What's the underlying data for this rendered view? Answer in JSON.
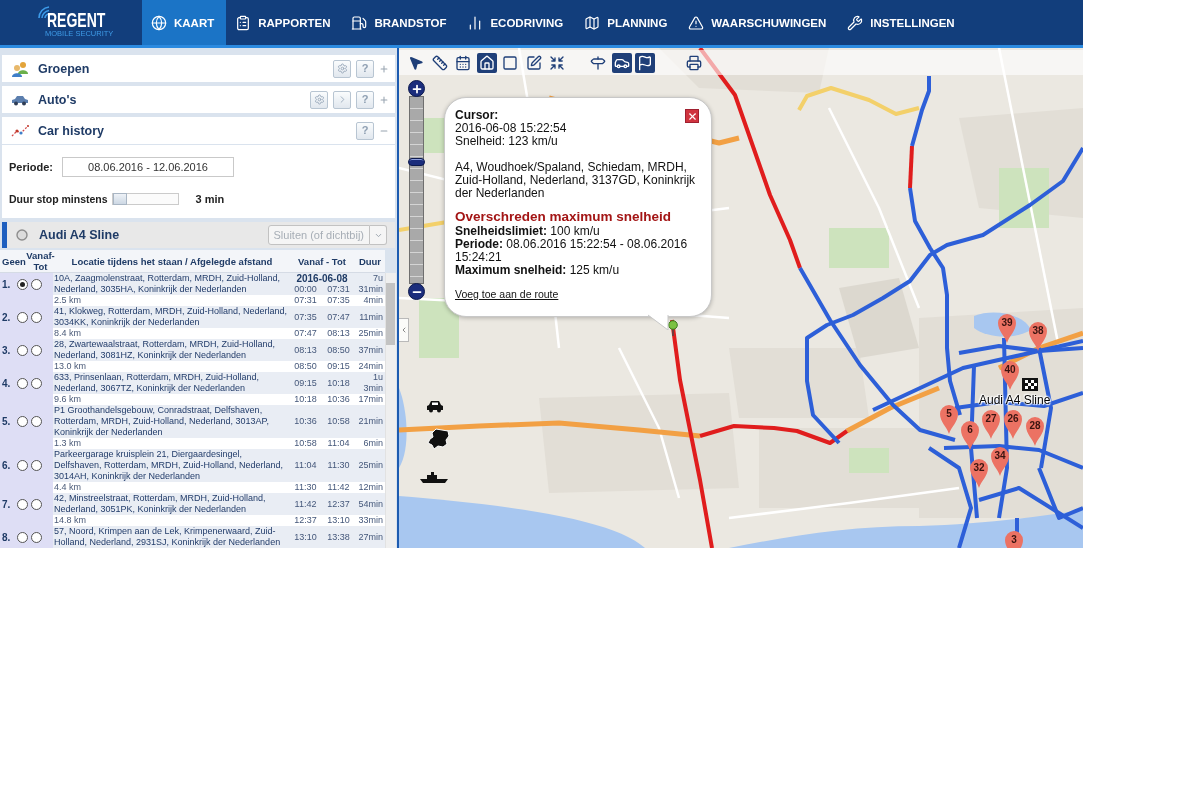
{
  "nav": {
    "logo": {
      "name": "REGENT",
      "tagline": "MOBILE SECURITY"
    },
    "tabs": [
      {
        "label": "KAART",
        "selected": true
      },
      {
        "label": "RAPPORTEN",
        "selected": false
      },
      {
        "label": "BRANDSTOF",
        "selected": false
      },
      {
        "label": "ECODRIVING",
        "selected": false
      },
      {
        "label": "PLANNING",
        "selected": false
      },
      {
        "label": "WAARSCHUWINGEN",
        "selected": false
      },
      {
        "label": "INSTELLINGEN",
        "selected": false
      }
    ]
  },
  "panels": [
    {
      "title": "Groepen",
      "expanded": false,
      "buttons": [
        {
          "kind": "settings"
        },
        {
          "kind": "help",
          "label": "?"
        }
      ]
    },
    {
      "title": "Auto's",
      "expanded": false,
      "buttons": [
        {
          "kind": "settings"
        },
        {
          "kind": "next"
        },
        {
          "kind": "help",
          "label": "?"
        }
      ]
    },
    {
      "title": "Car history",
      "expanded": true,
      "buttons": [
        {
          "kind": "help",
          "label": "?"
        }
      ]
    }
  ],
  "car_history": {
    "period": {
      "label": "Periode:",
      "value": "08.06.2016 - 12.06.2016"
    },
    "min_stop": {
      "label": "Duur stop minstens",
      "level": 0,
      "reading": "3 min"
    }
  },
  "vehicle": {
    "name": "Audi A4 Sline",
    "close_button": {
      "label": "Sluiten (of dichtbij)",
      "disabled": true
    }
  },
  "table": {
    "columns": [
      "Geen",
      "Vanaf-Tot",
      "Locatie tijdens het staan / Afgelegde afstand",
      "Vanaf - Tot",
      "Duur"
    ],
    "rows": [
      {
        "kind": "stop",
        "number": "1.",
        "options": [
          {
            "selected": true
          },
          {
            "selected": false
          }
        ],
        "location": "10A, Zaagmolenstraat, Rotterdam, MRDH, Zuid-Holland, Nederland, 3035HA, Koninkrijk der Nederlanden",
        "date": "2016-06-08",
        "from": "00:00",
        "to": "07:31",
        "duration": "7u 31min"
      },
      {
        "kind": "trip",
        "distance": "2.5 km",
        "from": "07:31",
        "to": "07:35",
        "duration": "4min"
      },
      {
        "kind": "stop",
        "number": "2.",
        "options": [
          {
            "selected": false
          },
          {
            "selected": false
          }
        ],
        "location": "41, Klokweg, Rotterdam, MRDH, Zuid-Holland, Nederland, 3034KK, Koninkrijk der Nederlanden",
        "from": "07:35",
        "to": "07:47",
        "duration": "11min"
      },
      {
        "kind": "trip",
        "distance": "8.4 km",
        "from": "07:47",
        "to": "08:13",
        "duration": "25min"
      },
      {
        "kind": "stop",
        "number": "3.",
        "options": [
          {
            "selected": false
          },
          {
            "selected": false
          }
        ],
        "location": "28, Zwartewaalstraat, Rotterdam, MRDH, Zuid-Holland, Nederland, 3081HZ, Koninkrijk der Nederlanden",
        "from": "08:13",
        "to": "08:50",
        "duration": "37min"
      },
      {
        "kind": "trip",
        "distance": "13.0 km",
        "from": "08:50",
        "to": "09:15",
        "duration": "24min"
      },
      {
        "kind": "stop",
        "number": "4.",
        "options": [
          {
            "selected": false
          },
          {
            "selected": false
          }
        ],
        "location": "633, Prinsenlaan, Rotterdam, MRDH, Zuid-Holland, Nederland, 3067TZ, Koninkrijk der Nederlanden",
        "from": "09:15",
        "to": "10:18",
        "duration": "1u 3min"
      },
      {
        "kind": "trip",
        "distance": "9.6 km",
        "from": "10:18",
        "to": "10:36",
        "duration": "17min"
      },
      {
        "kind": "stop",
        "number": "5.",
        "options": [
          {
            "selected": false
          },
          {
            "selected": false
          }
        ],
        "location": "P1 Groothandelsgebouw, Conradstraat, Delfshaven, Rotterdam, MRDH, Zuid-Holland, Nederland, 3013AP, Koninkrijk der Nederlanden",
        "from": "10:36",
        "to": "10:58",
        "duration": "21min"
      },
      {
        "kind": "trip",
        "distance": "1.3 km",
        "from": "10:58",
        "to": "11:04",
        "duration": "6min"
      },
      {
        "kind": "stop",
        "number": "6.",
        "options": [
          {
            "selected": false
          },
          {
            "selected": false
          }
        ],
        "location": "Parkeergarage kruisplein 21, Diergaardesingel, Delfshaven, Rotterdam, MRDH, Zuid-Holland, Nederland, 3014AH, Koninkrijk der Nederlanden",
        "from": "11:04",
        "to": "11:30",
        "duration": "25min"
      },
      {
        "kind": "trip",
        "distance": "4.4 km",
        "from": "11:30",
        "to": "11:42",
        "duration": "12min"
      },
      {
        "kind": "stop",
        "number": "7.",
        "options": [
          {
            "selected": false
          },
          {
            "selected": false
          }
        ],
        "location": "42, Minstreelstraat, Rotterdam, MRDH, Zuid-Holland, Nederland, 3051PK, Koninkrijk der Nederlanden",
        "from": "11:42",
        "to": "12:37",
        "duration": "54min"
      },
      {
        "kind": "trip",
        "distance": "14.8 km",
        "from": "12:37",
        "to": "13:10",
        "duration": "33min"
      },
      {
        "kind": "stop",
        "number": "8.",
        "options": [
          {
            "selected": false
          },
          {
            "selected": false
          }
        ],
        "location": "57, Noord, Krimpen aan de Lek, Krimpenerwaard, Zuid-Holland, Nederland, 2931SJ, Koninkrijk der Nederlanden",
        "from": "13:10",
        "to": "13:38",
        "duration": "27min"
      }
    ]
  },
  "map": {
    "tools": [
      {
        "kind": "pointer",
        "selected": false
      },
      {
        "kind": "ruler",
        "selected": false
      },
      {
        "kind": "calendar",
        "selected": false
      },
      {
        "kind": "home",
        "selected": true
      },
      {
        "kind": "area",
        "selected": false
      },
      {
        "kind": "edit",
        "selected": false
      },
      {
        "kind": "fit",
        "selected": false
      },
      {
        "kind": "signpost",
        "selected": false
      },
      {
        "kind": "vehicles",
        "selected": true
      },
      {
        "kind": "flags",
        "selected": true
      },
      {
        "kind": "print",
        "selected": false
      }
    ],
    "zoom": {
      "level": 0.66
    },
    "popup": {
      "lines": [
        {
          "kind": "label",
          "text": "Cursor:"
        },
        {
          "kind": "text",
          "text": "2016-06-08 15:22:54"
        },
        {
          "kind": "text",
          "text": "Snelheid: 123 km/u"
        },
        {
          "kind": "address",
          "text": "A4, Woudhoek/Spaland, Schiedam, MRDH, Zuid-Holland, Nederland, 3137GD, Koninkrijk der Nederlanden"
        },
        {
          "kind": "alert",
          "text": "Overschreden maximum snelheid"
        },
        {
          "kind": "text",
          "text": "**Snelheidslimiet:** 100 km/u"
        },
        {
          "kind": "text",
          "text": "**Periode:** 08.06.2016 15:22:54 - 08.06.2016 15:24:21"
        },
        {
          "kind": "text",
          "text": "**Maximum snelheid:** 125 km/u"
        },
        {
          "kind": "link",
          "text": "Voeg toe aan de route"
        }
      ]
    },
    "markers": [
      {
        "label": "39"
      },
      {
        "label": "38"
      },
      {
        "label": "40"
      },
      {
        "label": "27"
      },
      {
        "label": "26"
      },
      {
        "label": "5"
      },
      {
        "label": "6"
      },
      {
        "label": "28"
      },
      {
        "label": "34"
      },
      {
        "label": "32"
      },
      {
        "label": "3"
      }
    ],
    "vehicle_label": "Audi A4 Sline"
  }
}
